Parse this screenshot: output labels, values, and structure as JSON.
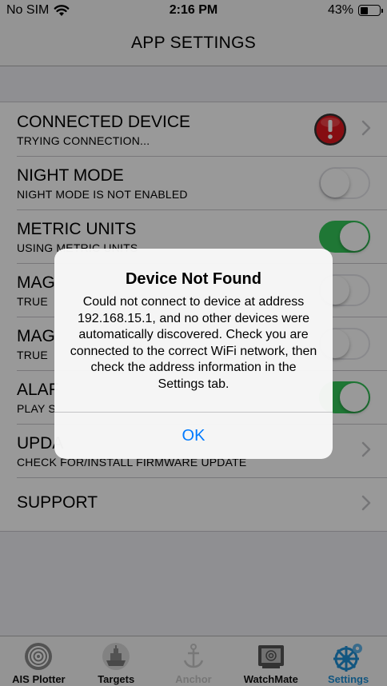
{
  "status_bar": {
    "carrier": "No SIM",
    "time": "2:16 PM",
    "battery_percent": "43%",
    "battery_level": 0.43
  },
  "nav": {
    "title": "APP SETTINGS"
  },
  "settings": {
    "rows": [
      {
        "title": "CONNECTED DEVICE",
        "subtitle": "TRYING CONNECTION...",
        "control": "alert-chevron"
      },
      {
        "title": "NIGHT MODE",
        "subtitle": "NIGHT MODE IS NOT ENABLED",
        "control": "toggle",
        "on": false
      },
      {
        "title": "METRIC UNITS",
        "subtitle": "USING METRIC UNITS",
        "control": "toggle",
        "on": true
      },
      {
        "title": "MAG",
        "subtitle": "TRUE",
        "control": "toggle",
        "on": false
      },
      {
        "title": "MAG",
        "subtitle": "TRUE",
        "control": "toggle",
        "on": false
      },
      {
        "title": "ALAF",
        "subtitle": "PLAY S",
        "control": "toggle",
        "on": true
      },
      {
        "title": "UPDA",
        "subtitle": "CHECK FOR/INSTALL FIRMWARE UPDATE",
        "control": "chevron"
      },
      {
        "title": "SUPPORT",
        "subtitle": "",
        "control": "chevron"
      }
    ]
  },
  "dialog": {
    "title": "Device Not Found",
    "message": "Could not connect to device at address 192.168.15.1, and no other devices were automatically discovered. Check you are connected to the correct WiFi network, then check the address information in the Settings tab.",
    "ok_label": "OK"
  },
  "tabs": [
    {
      "label": "AIS Plotter",
      "icon": "radar-icon",
      "state": "normal"
    },
    {
      "label": "Targets",
      "icon": "ship-icon",
      "state": "normal"
    },
    {
      "label": "Anchor",
      "icon": "anchor-icon",
      "state": "disabled"
    },
    {
      "label": "WatchMate",
      "icon": "device-icon",
      "state": "normal"
    },
    {
      "label": "Settings",
      "icon": "helm-gear-icon",
      "state": "active"
    }
  ],
  "colors": {
    "toggle_on": "#34c759",
    "link_blue": "#007aff",
    "alert_red": "#e0161f",
    "active_tab": "#1f8fd6"
  }
}
